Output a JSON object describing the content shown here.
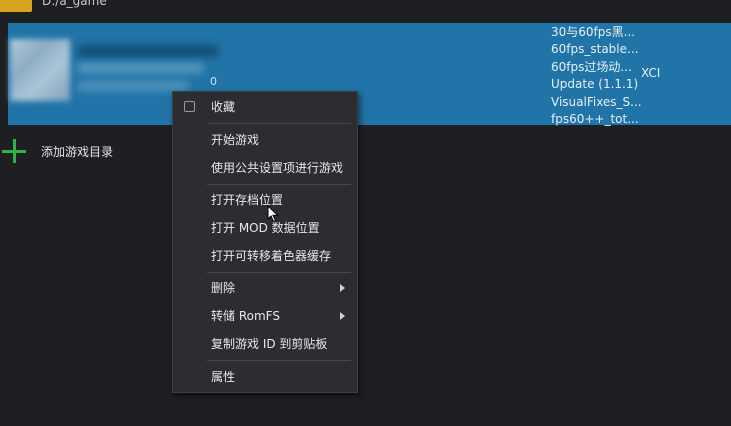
{
  "path_bar": {
    "path": "D:/a_game",
    "folder_color": "#d6a51f"
  },
  "game_row": {
    "version_tail": "0",
    "addons": [
      "30与60fps黑...",
      "60fps_stable...",
      "60fps过场动...",
      "Update (1.1.1)",
      "VisualFixes_S...",
      "fps60++_tot..."
    ],
    "file_type": "XCI",
    "highlight_color": "#2174a8"
  },
  "add_dir": {
    "label": "添加游戏目录",
    "icon": "plus-icon",
    "icon_color": "#2eb24a"
  },
  "context_menu": {
    "favorite": "收藏",
    "start_game": "开始游戏",
    "start_with_global": "使用公共设置项进行游戏",
    "open_save": "打开存档位置",
    "open_mod": "打开 MOD 数据位置",
    "open_shader_cache": "打开可转移着色器缓存",
    "delete": "删除",
    "dump_romfs": "转储 RomFS",
    "copy_title_id": "复制游戏 ID 到剪贴板",
    "properties": "属性"
  }
}
